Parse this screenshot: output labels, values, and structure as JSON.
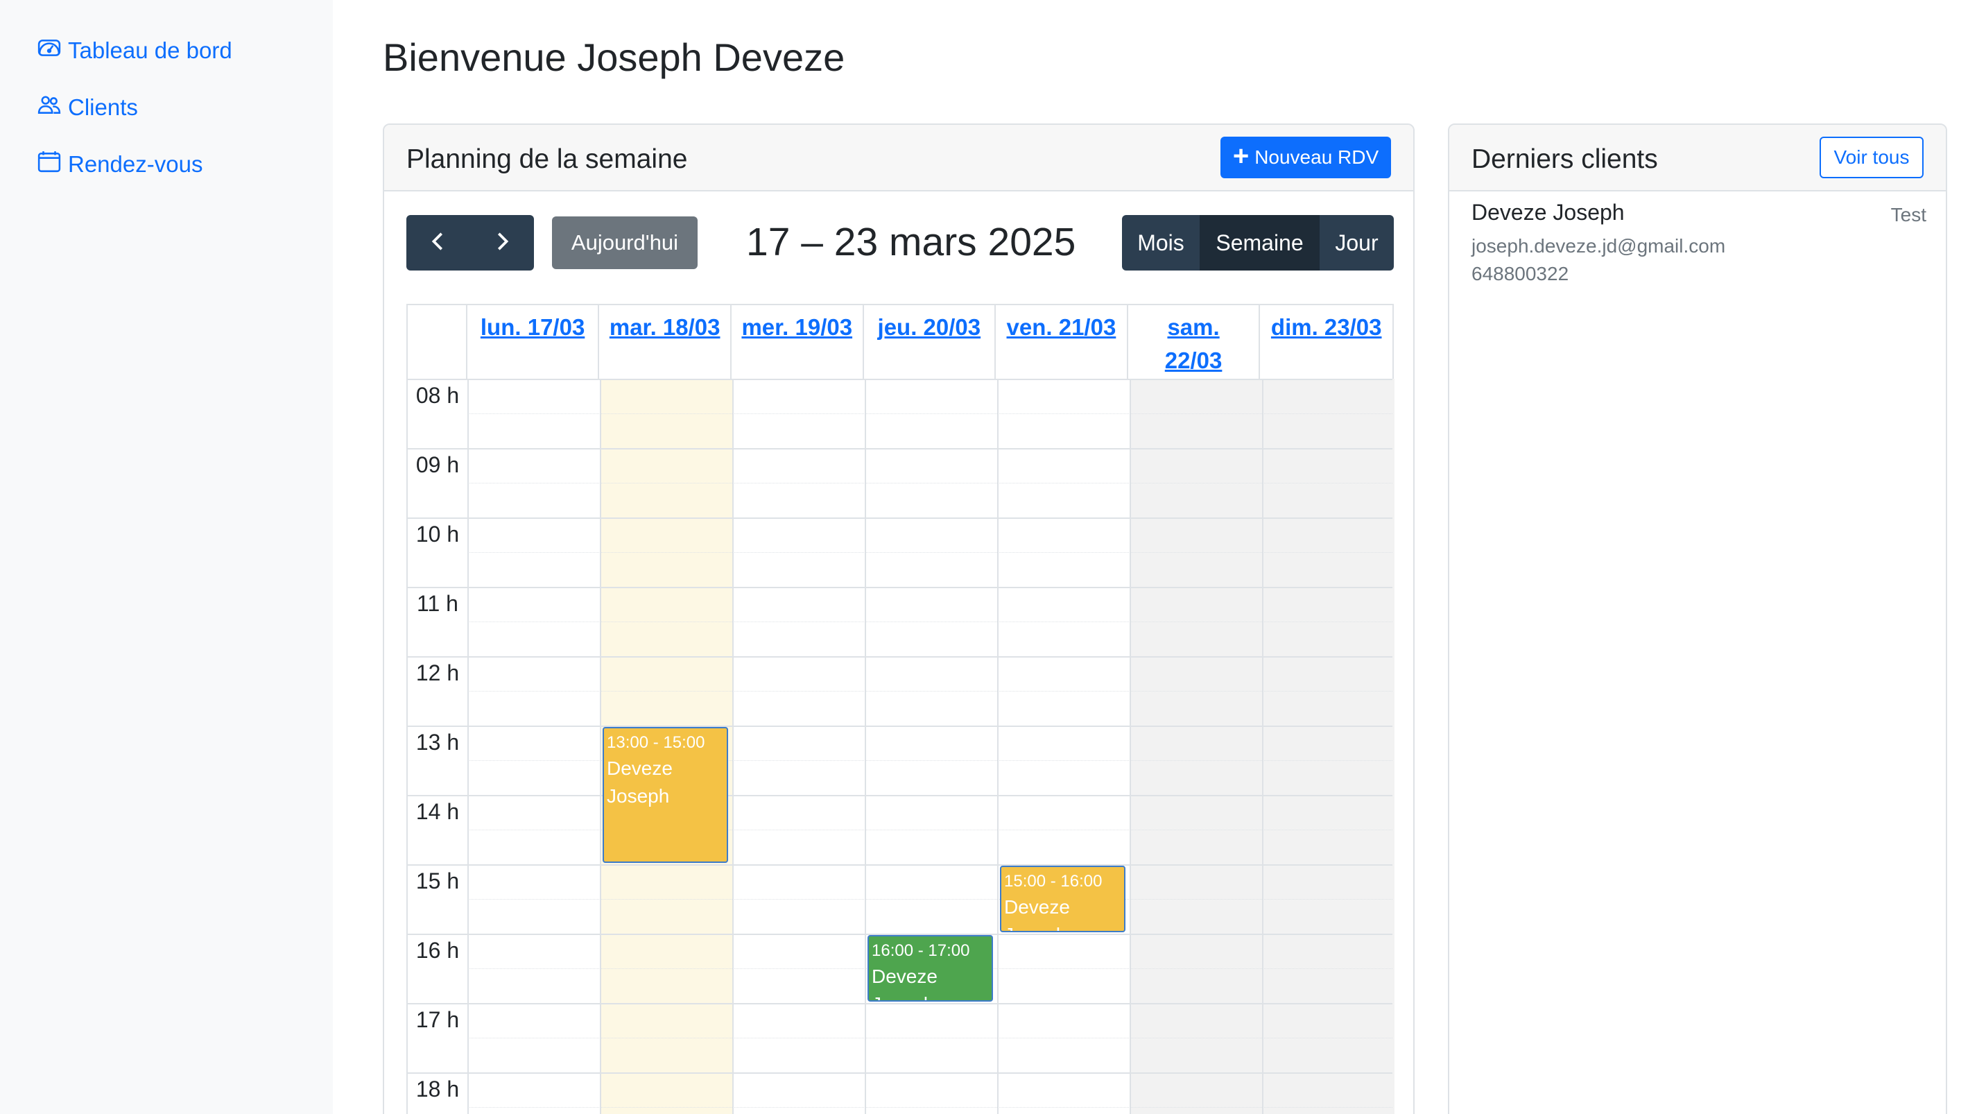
{
  "sidebar": {
    "items": [
      {
        "label": "Tableau de bord",
        "icon": "dashboard-icon"
      },
      {
        "label": "Clients",
        "icon": "users-icon"
      },
      {
        "label": "Rendez-vous",
        "icon": "calendar-icon"
      }
    ]
  },
  "page": {
    "title": "Bienvenue Joseph Deveze"
  },
  "planning": {
    "title": "Planning de la semaine",
    "new_button_icon": "+",
    "new_button_label": "Nouveau RDV",
    "prev_icon": "chevron-left-icon",
    "next_icon": "chevron-right-icon",
    "today_label": "Aujourd'hui",
    "range_title": "17 – 23 mars 2025",
    "views": {
      "month": "Mois",
      "week": "Semaine",
      "day": "Jour"
    },
    "active_view": "Semaine",
    "days": [
      "lun. 17/03",
      "mar. 18/03",
      "mer. 19/03",
      "jeu. 20/03",
      "ven. 21/03",
      "sam. 22/03",
      "dim. 23/03"
    ],
    "today_index": 1,
    "weekend_indices": [
      5,
      6
    ],
    "hours": [
      "08 h",
      "09 h",
      "10 h",
      "11 h",
      "12 h",
      "13 h",
      "14 h",
      "15 h",
      "16 h",
      "17 h",
      "18 h"
    ],
    "events": [
      {
        "day_index": 1,
        "start": 13,
        "end": 15,
        "time": "13:00 - 15:00",
        "title": "Deveze Joseph",
        "color": "#f4c245"
      },
      {
        "day_index": 4,
        "start": 15,
        "end": 16,
        "time": "15:00 - 16:00",
        "title": "Deveze Joseph",
        "color": "#f4c245"
      },
      {
        "day_index": 3,
        "start": 16,
        "end": 17,
        "time": "16:00 - 17:00",
        "title": "Deveze Joseph",
        "color": "#4ea54e"
      }
    ]
  },
  "clients": {
    "title": "Derniers clients",
    "view_all_label": "Voir tous",
    "items": [
      {
        "name": "Deveze Joseph",
        "tag": "Test",
        "email": "joseph.deveze.jd@gmail.com",
        "phone": "648800322"
      }
    ]
  },
  "colors": {
    "primary": "#0d6efd",
    "toolbar_dark": "#2c3e50",
    "today_column": "#fdf8e4",
    "weekend_column": "#f2f2f2"
  }
}
